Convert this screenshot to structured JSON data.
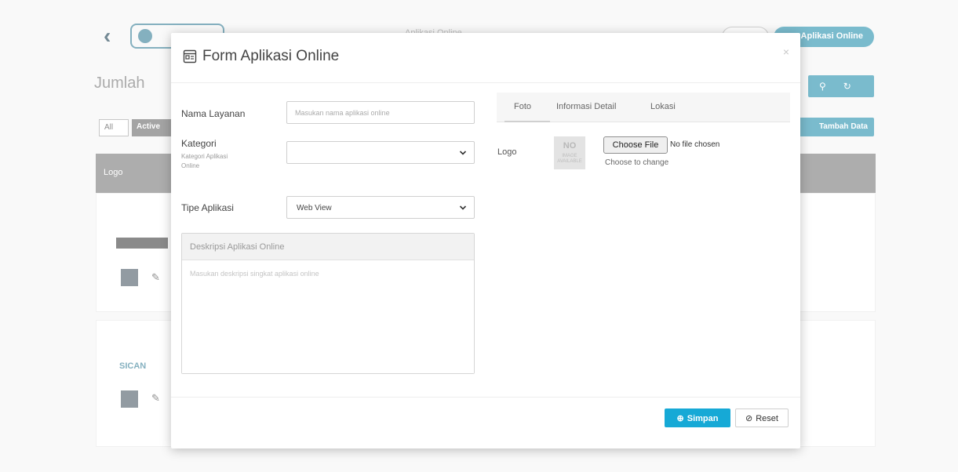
{
  "background": {
    "breadcrumb": [
      "Aplikasi Online"
    ],
    "top_button": "Aplikasi Online",
    "jumlah": "Jumlah",
    "filters": [
      "All",
      "Active"
    ],
    "tambah_button": "Tambah Data",
    "table_head": "Logo",
    "row_label_sican": "SICAN"
  },
  "modal": {
    "title": "Form Aplikasi Online",
    "close": "×",
    "form": {
      "nama_layanan_label": "Nama Layanan",
      "nama_layanan_placeholder": "Masukan nama aplikasi online",
      "kategori_label": "Kategori",
      "kategori_sub": "Kategori Aplikasi Online",
      "kategori_value": "",
      "tipe_label": "Tipe Aplikasi",
      "tipe_value": "Web View",
      "deskripsi_label": "Deskripsi Aplikasi Online",
      "deskripsi_placeholder": "Masukan deskripsi singkat aplikasi online"
    },
    "tabs": [
      "Foto",
      "Informasi Detail",
      "Lokasi"
    ],
    "active_tab": "Foto",
    "logo": {
      "label": "Logo",
      "thumb_big": "NO",
      "thumb_small": "IMAGE AVAILABLE",
      "file_button": "Choose File",
      "file_status": "No file chosen",
      "hint": "Choose to change"
    },
    "footer": {
      "simpan": "Simpan",
      "reset": "Reset"
    }
  },
  "colors": {
    "primary": "#16a9d6",
    "dark_teal": "#0e83a5",
    "header_gray": "#6b6b6b"
  }
}
